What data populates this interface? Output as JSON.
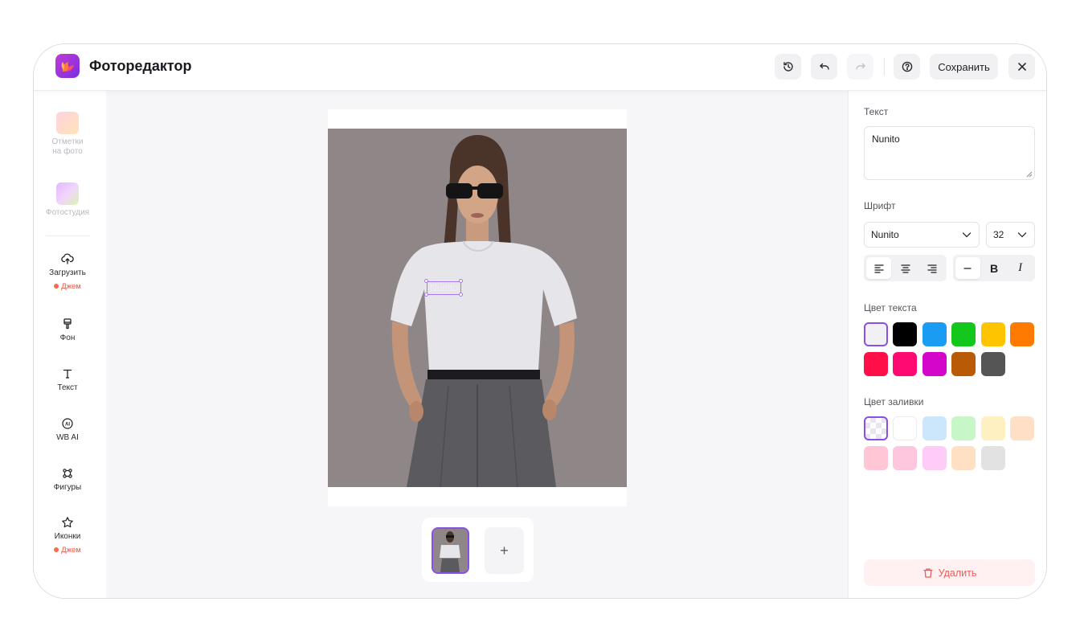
{
  "header": {
    "title": "Фоторедактор",
    "save_label": "Сохранить"
  },
  "toolbar": {
    "items": [
      {
        "label": "Отметки на фото",
        "icon": "tag-tile-icon",
        "enabled": false
      },
      {
        "label": "Фотостудия",
        "icon": "studio-tile-icon",
        "enabled": false
      },
      {
        "label": "Загрузить",
        "icon": "upload-cloud-icon",
        "badge": "Джем",
        "enabled": true
      },
      {
        "label": "Фон",
        "icon": "paint-brush-icon",
        "enabled": true
      },
      {
        "label": "Текст",
        "icon": "text-icon",
        "enabled": true
      },
      {
        "label": "WB AI",
        "icon": "ai-icon",
        "enabled": true
      },
      {
        "label": "Фигуры",
        "icon": "shapes-icon",
        "enabled": true
      },
      {
        "label": "Иконки",
        "icon": "star-icon",
        "badge": "Джем",
        "enabled": true
      }
    ]
  },
  "canvas": {
    "text_layer": "Nunito",
    "add_page_label": "+"
  },
  "panel": {
    "text_label": "Текст",
    "text_value": "Nunito",
    "font_label": "Шрифт",
    "font_value": "Nunito",
    "size_value": "32",
    "bold_label": "B",
    "italic_label": "I",
    "text_color_label": "Цвет текста",
    "text_colors": [
      "#f1f1f5",
      "#000000",
      "#1a9cf5",
      "#13c71b",
      "#ffc400",
      "#ff7a00",
      "#ff0f47",
      "#ff0a72",
      "#d406c9",
      "#b95a06",
      "#555555"
    ],
    "fill_color_label": "Цвет заливки",
    "fill_colors": [
      "transparent",
      "#ffffff",
      "#cce6fb",
      "#c7f6c9",
      "#fff0c2",
      "#ffe0c7",
      "#ffc7d6",
      "#ffc7dd",
      "#ffccf7",
      "#ffe0c2",
      "#e2e2e2"
    ],
    "delete_label": "Удалить"
  }
}
